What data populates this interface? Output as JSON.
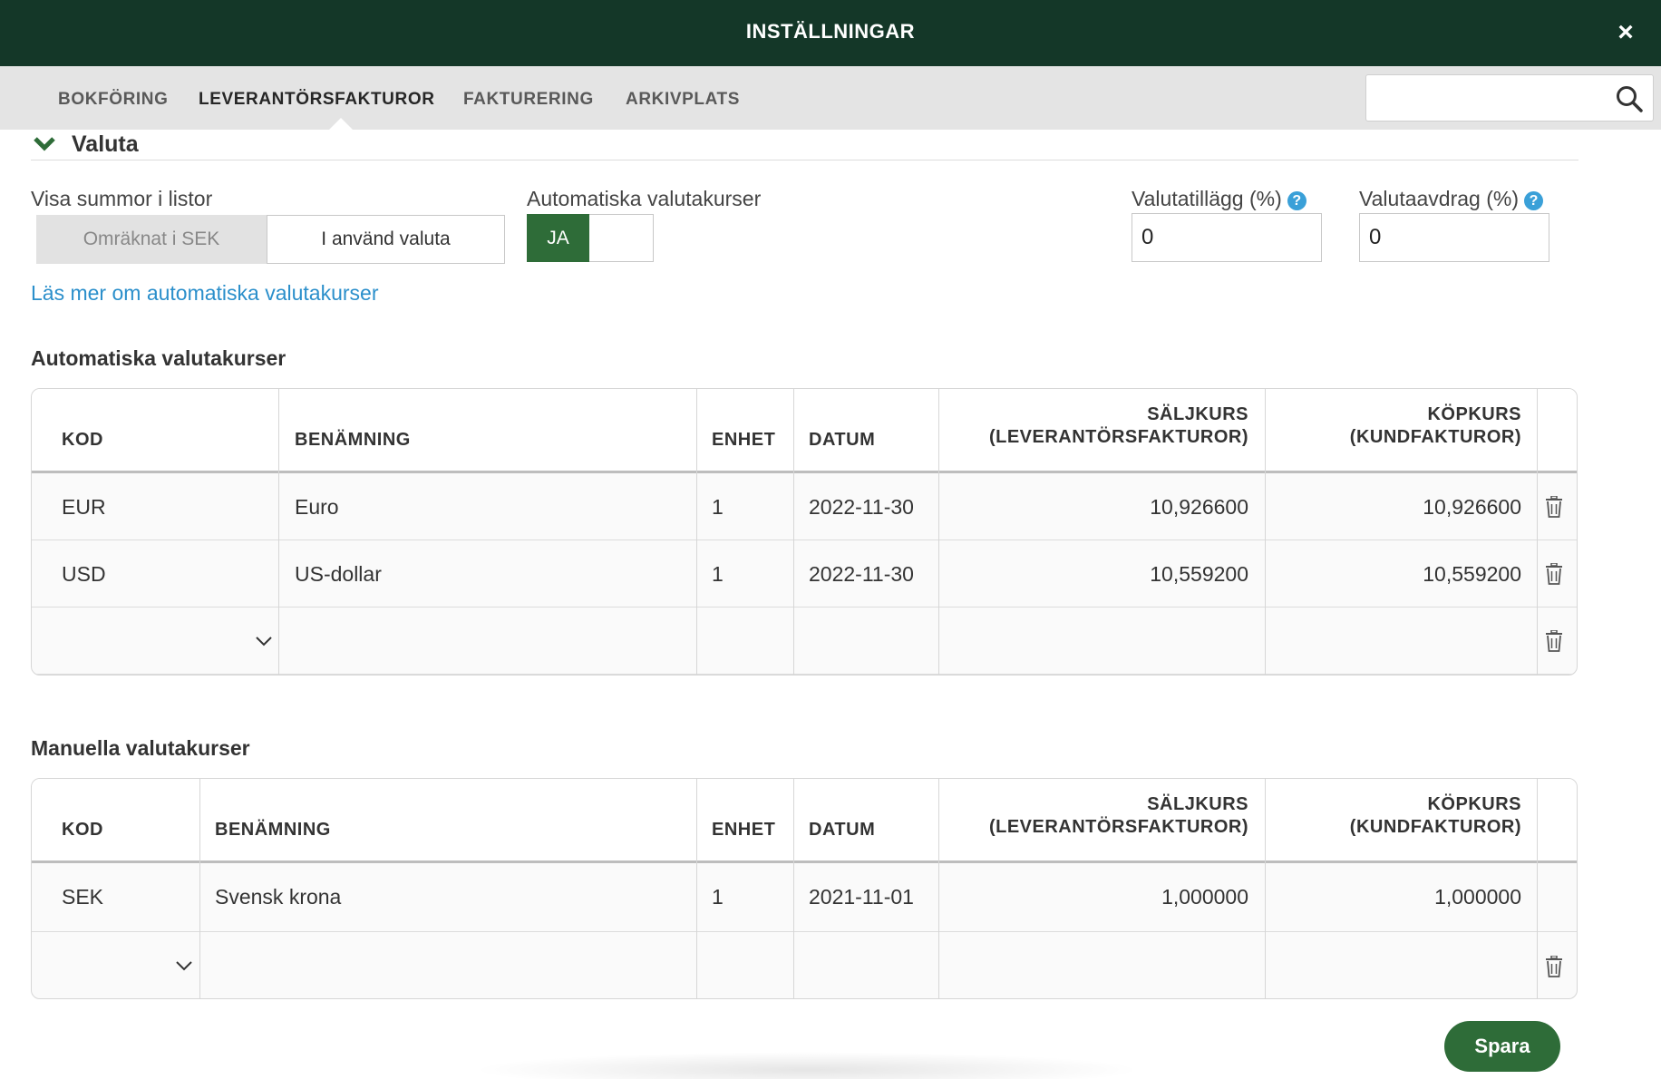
{
  "header": {
    "title": "INSTÄLLNINGAR",
    "close_label": "×"
  },
  "tabs": [
    {
      "label": "BOKFÖRING",
      "active": false
    },
    {
      "label": "LEVERANTÖRSFAKTUROR",
      "active": true
    },
    {
      "label": "FAKTURERING",
      "active": false
    },
    {
      "label": "ARKIVPLATS",
      "active": false
    }
  ],
  "search": {
    "value": "",
    "placeholder": ""
  },
  "section": {
    "title": "Valuta"
  },
  "form": {
    "visa_summor_label": "Visa summor i listor",
    "visa_summor_options": [
      "Omräknat i SEK",
      "I använd valuta"
    ],
    "visa_summor_selected": "I använd valuta",
    "auto_kurser_label": "Automatiska valutakurser",
    "auto_kurser_toggle": "JA",
    "valutatillagg_label": "Valutatillägg (%)",
    "valutatillagg_value": "0",
    "valutaavdrag_label": "Valutaavdrag (%)",
    "valutaavdrag_value": "0",
    "help_glyph": "?",
    "read_more_link": "Läs mer om automatiska valutakurser"
  },
  "auto_table": {
    "title": "Automatiska valutakurser",
    "columns": {
      "kod": "KOD",
      "benamning": "BENÄMNING",
      "enhet": "ENHET",
      "datum": "DATUM",
      "saljkurs_1": "SÄLJKURS",
      "saljkurs_2": "(LEVERANTÖRSFAKTUROR)",
      "kopkurs_1": "KÖPKURS",
      "kopkurs_2": "(KUNDFAKTUROR)"
    },
    "rows": [
      {
        "kod": "EUR",
        "benamning": "Euro",
        "enhet": "1",
        "datum": "2022-11-30",
        "saljkurs": "10,926600",
        "kopkurs": "10,926600"
      },
      {
        "kod": "USD",
        "benamning": "US-dollar",
        "enhet": "1",
        "datum": "2022-11-30",
        "saljkurs": "10,559200",
        "kopkurs": "10,559200"
      }
    ]
  },
  "manual_table": {
    "title": "Manuella valutakurser",
    "columns": {
      "kod": "KOD",
      "benamning": "BENÄMNING",
      "enhet": "ENHET",
      "datum": "DATUM",
      "saljkurs_1": "SÄLJKURS",
      "saljkurs_2": "(LEVERANTÖRSFAKTUROR)",
      "kopkurs_1": "KÖPKURS",
      "kopkurs_2": "(KUNDFAKTUROR)"
    },
    "rows": [
      {
        "kod": "SEK",
        "benamning": "Svensk krona",
        "enhet": "1",
        "datum": "2021-11-01",
        "saljkurs": "1,000000",
        "kopkurs": "1,000000"
      }
    ]
  },
  "actions": {
    "save_label": "Spara"
  },
  "colors": {
    "header_bg": "#143728",
    "accent_green": "#2e6c38",
    "link_blue": "#2b8fcb",
    "help_blue": "#3aa0d8"
  }
}
